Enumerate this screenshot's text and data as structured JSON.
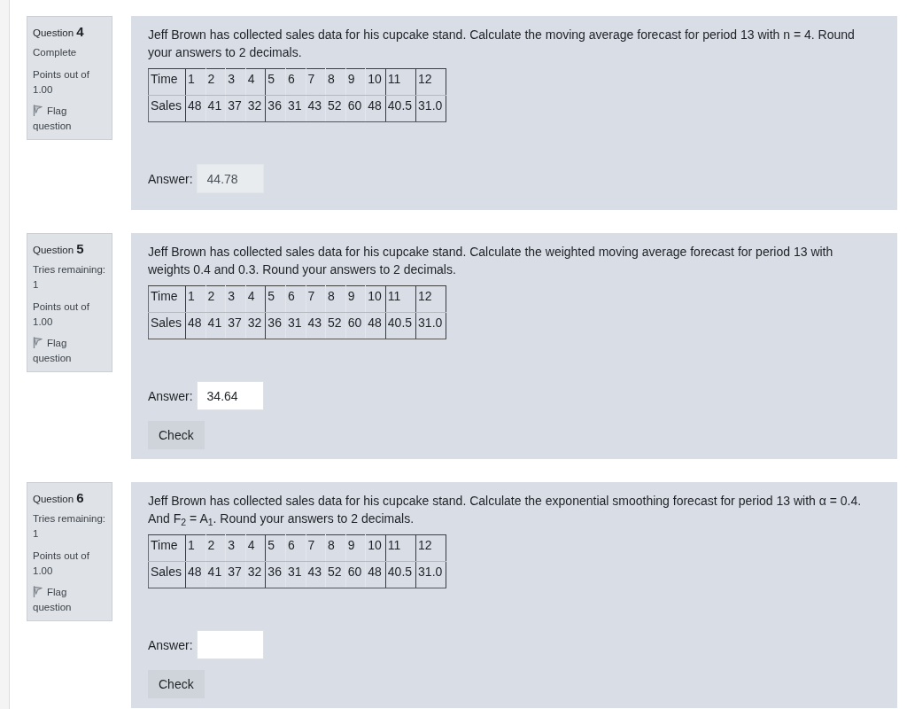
{
  "questions": [
    {
      "label": "Question",
      "number": "4",
      "status": "Complete",
      "points": "Points out of 1.00",
      "flag": "Flag question",
      "text": "Jeff Brown has collected sales data for his cupcake stand. Calculate the moving average forecast for period 13 with n = 4. Round your answers to 2 decimals.",
      "table": {
        "rows": [
          {
            "header": "Time",
            "cells": [
              "1",
              "2",
              "3",
              "4",
              "5",
              "6",
              "7",
              "8",
              "9",
              "10",
              "11",
              "12"
            ]
          },
          {
            "header": "Sales",
            "cells": [
              "48",
              "41",
              "37",
              "32",
              "36",
              "31",
              "43",
              "52",
              "60",
              "48",
              "40.5",
              "31.0"
            ]
          }
        ]
      },
      "answer": {
        "label": "Answer:",
        "value": "44.78",
        "readonly": true
      }
    },
    {
      "label": "Question",
      "number": "5",
      "status": "Tries remaining: 1",
      "points": "Points out of 1.00",
      "flag": "Flag question",
      "text": "Jeff Brown has collected sales data for his cupcake stand. Calculate the weighted moving average forecast for period 13 with weights 0.4 and 0.3. Round your answers to 2 decimals.",
      "table": {
        "rows": [
          {
            "header": "Time",
            "cells": [
              "1",
              "2",
              "3",
              "4",
              "5",
              "6",
              "7",
              "8",
              "9",
              "10",
              "11",
              "12"
            ]
          },
          {
            "header": "Sales",
            "cells": [
              "48",
              "41",
              "37",
              "32",
              "36",
              "31",
              "43",
              "52",
              "60",
              "48",
              "40.5",
              "31.0"
            ]
          }
        ]
      },
      "answer": {
        "label": "Answer:",
        "value": "34.64",
        "readonly": false
      },
      "check_button": "Check"
    },
    {
      "label": "Question",
      "number": "6",
      "status": "Tries remaining: 1",
      "points": "Points out of 1.00",
      "flag": "Flag question",
      "text": "Jeff Brown has collected sales data for his cupcake stand. Calculate the exponential smoothing forecast for period 13 with α = 0.4. And F$_{2}$ = A$_{1}$. Round your answers to 2 decimals.",
      "table": {
        "rows": [
          {
            "header": "Time",
            "cells": [
              "1",
              "2",
              "3",
              "4",
              "5",
              "6",
              "7",
              "8",
              "9",
              "10",
              "11",
              "12"
            ]
          },
          {
            "header": "Sales",
            "cells": [
              "48",
              "41",
              "37",
              "32",
              "36",
              "31",
              "43",
              "52",
              "60",
              "48",
              "40.5",
              "31.0"
            ]
          }
        ]
      },
      "answer": {
        "label": "Answer:",
        "readonly": false
      },
      "check_button": "Check"
    }
  ]
}
